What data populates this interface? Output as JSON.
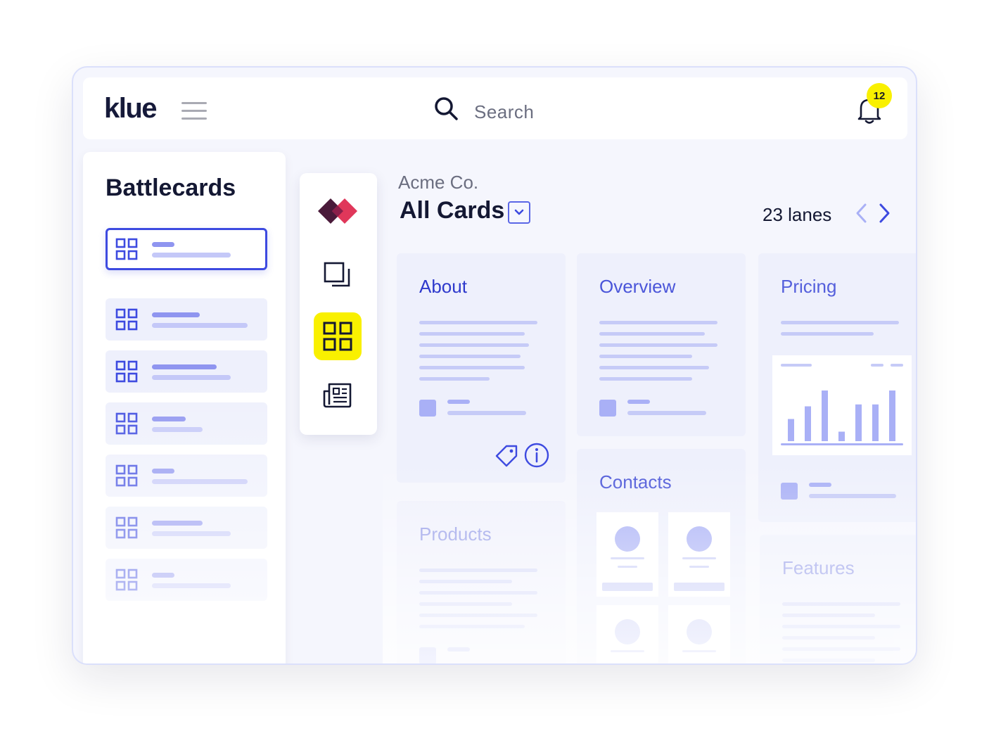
{
  "app": {
    "logo": "klue"
  },
  "header": {
    "search_placeholder": "Search",
    "notification_count": "12"
  },
  "sidebar": {
    "title": "Battlecards",
    "items": [
      {
        "active": true
      },
      {
        "active": false
      },
      {
        "active": false
      },
      {
        "active": false
      },
      {
        "active": false
      },
      {
        "active": false
      },
      {
        "active": false
      }
    ]
  },
  "toolrail": {
    "tools": [
      {
        "icon": "competitor-logo-icon"
      },
      {
        "icon": "copy-icon"
      },
      {
        "icon": "grid-icon",
        "active": true
      },
      {
        "icon": "newspaper-icon"
      }
    ]
  },
  "board": {
    "company": "Acme Co.",
    "view": "All Cards",
    "lanes": "23 lanes"
  },
  "cards": {
    "about": "About",
    "overview": "Overview",
    "pricing": "Pricing",
    "products": "Products",
    "contacts": "Contacts",
    "features": "Features"
  },
  "pricing_chart_data": {
    "type": "bar",
    "values": [
      0.35,
      0.55,
      0.8,
      0.15,
      0.58,
      0.58,
      0.8
    ]
  },
  "colors": {
    "accent": "#3d4ae0",
    "highlight": "#f9f000",
    "card_bg": "#eef0fc",
    "placeholder": "#c6cbf7"
  }
}
